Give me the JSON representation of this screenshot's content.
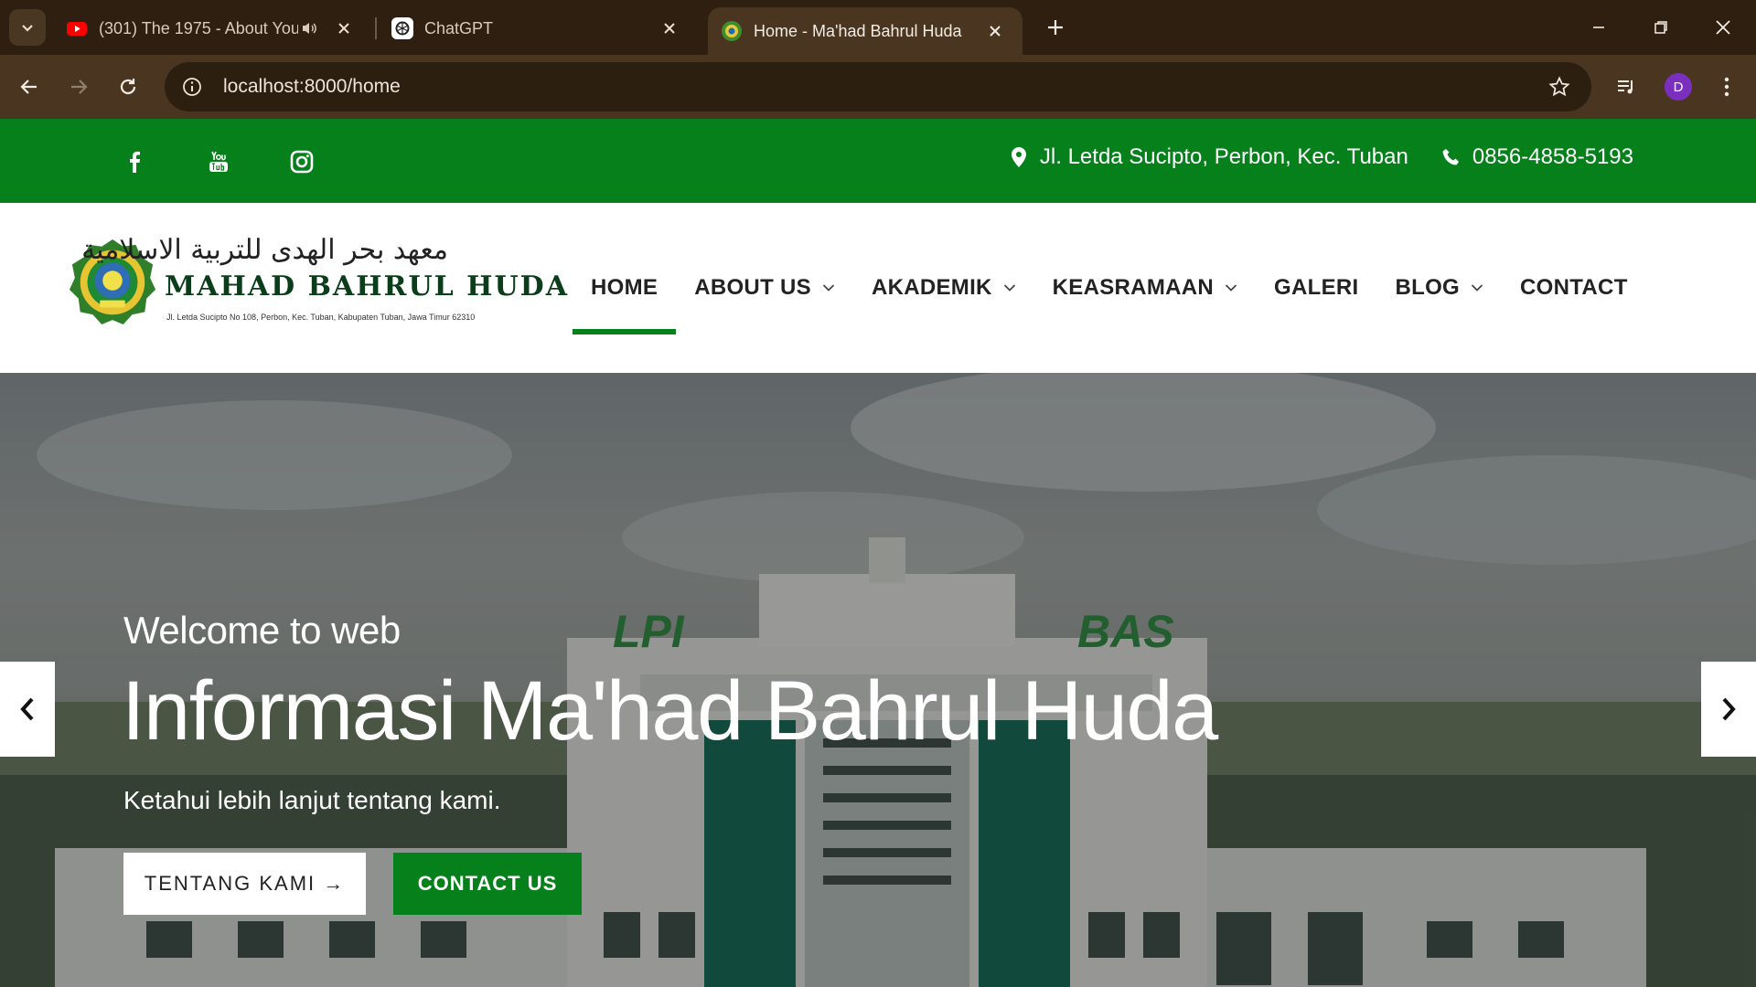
{
  "browser": {
    "tabs": [
      {
        "title": "(301) The 1975 - About You",
        "icon": "youtube-icon"
      },
      {
        "title": "ChatGPT",
        "icon": "chatgpt-icon"
      },
      {
        "title": "Home - Ma'had Bahrul Huda",
        "icon": "site-favicon",
        "active": true
      }
    ],
    "url": "localhost:8000/home",
    "profile_initial": "D"
  },
  "topbar": {
    "socials": [
      "facebook-icon",
      "youtube-icon",
      "instagram-icon"
    ],
    "address": "Jl. Letda Sucipto, Perbon, Kec. Tuban",
    "phone": "0856-4858-5193"
  },
  "logo": {
    "arabic": "معهد بحر الهدى للتربية الاسلامية",
    "name": "MAHAD BAHRUL HUDA",
    "address": "Jl. Letda Sucipto No 108, Perbon, Kec. Tuban, Kabupaten Tuban, Jawa Timur 62310"
  },
  "nav": {
    "items": [
      {
        "label": "HOME",
        "dropdown": false,
        "active": true
      },
      {
        "label": "ABOUT US",
        "dropdown": true
      },
      {
        "label": "AKADEMIK",
        "dropdown": true
      },
      {
        "label": "KEASRAMAAN",
        "dropdown": true
      },
      {
        "label": "GALERI",
        "dropdown": false
      },
      {
        "label": "BLOG",
        "dropdown": true
      },
      {
        "label": "CONTACT",
        "dropdown": false
      }
    ]
  },
  "hero": {
    "eyebrow": "Welcome to web",
    "title": "Informasi Ma'had Bahrul Huda",
    "subtitle": "Ketahui lebih lanjut tentang kami.",
    "primary_button": "TENTANG KAMI →",
    "secondary_button": "CONTACT US",
    "building_signs": [
      "LPI",
      "BAS"
    ]
  },
  "colors": {
    "brand_green": "#06801b",
    "chrome_dark": "#2e1f10",
    "chrome_toolbar": "#4a3620"
  }
}
